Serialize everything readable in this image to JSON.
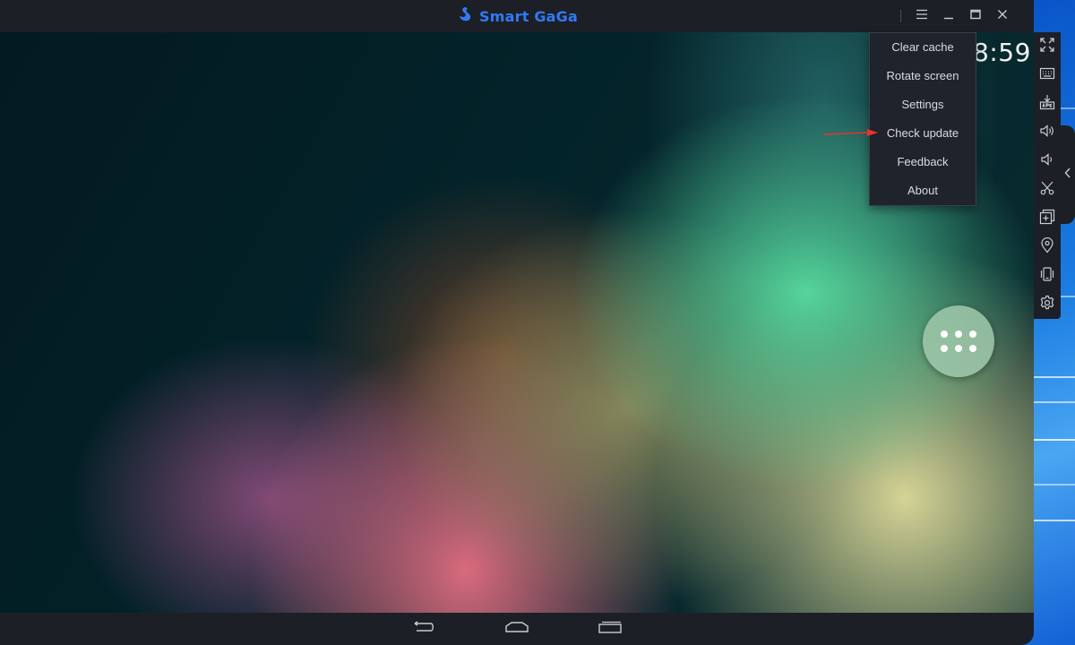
{
  "app": {
    "title": "Smart GaGa"
  },
  "android": {
    "clock": "8:59"
  },
  "menu": {
    "items": [
      {
        "label": "Clear cache"
      },
      {
        "label": "Rotate screen"
      },
      {
        "label": "Settings"
      },
      {
        "label": "Check update"
      },
      {
        "label": "Feedback"
      },
      {
        "label": "About"
      }
    ]
  },
  "toolbar": {
    "icons": [
      "fullscreen-icon",
      "keyboard-icon",
      "apk-install-icon",
      "volume-up-icon",
      "volume-down-icon",
      "scissors-icon",
      "multi-instance-icon",
      "location-icon",
      "shake-icon",
      "settings-gear-icon"
    ]
  },
  "nav": {
    "icons": [
      "back-icon",
      "home-icon",
      "recents-icon"
    ]
  },
  "colors": {
    "brand": "#2f7bf5",
    "window_bg": "#1d1f27",
    "menu_bg": "#1f232c",
    "annotation": "#e8322b"
  }
}
